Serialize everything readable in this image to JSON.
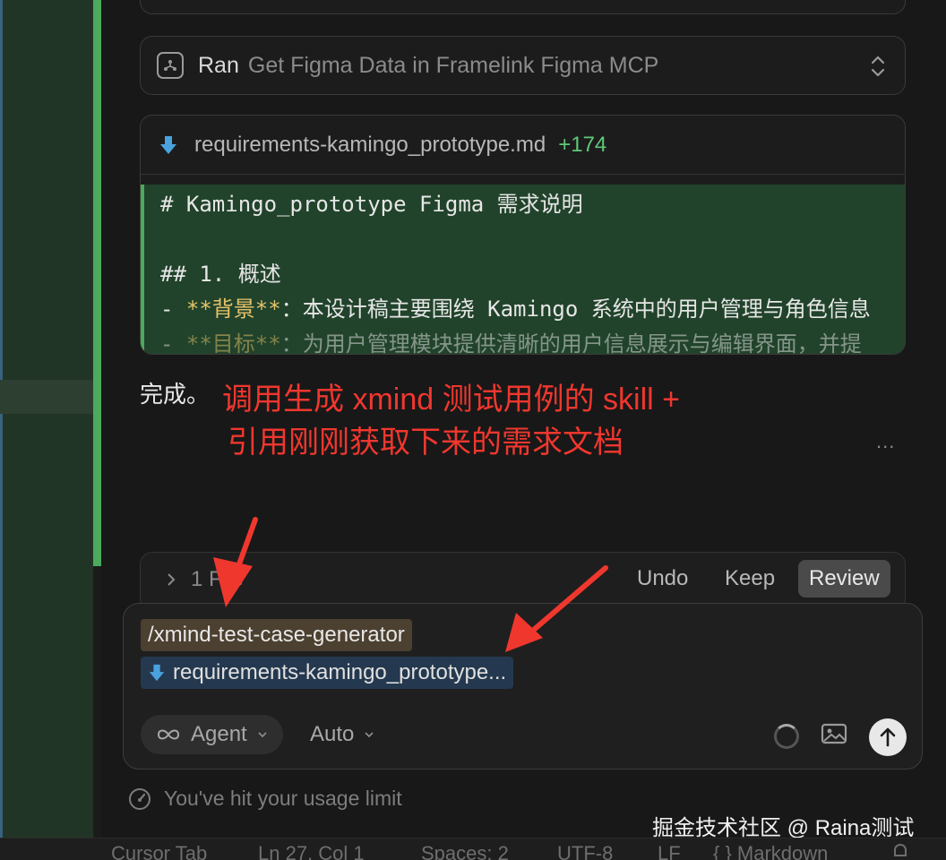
{
  "ran_card": {
    "prefix": "Ran",
    "tool": "Get Figma Data in Framelink Figma MCP"
  },
  "file_card": {
    "filename": "requirements-kamingo_prototype.md",
    "added": "+174",
    "lines": [
      {
        "text": "# Kamingo_prototype Figma 需求说明"
      },
      {
        "text": ""
      },
      {
        "text": "## 1. 概述"
      },
      {
        "prefix": "- ",
        "bold": "**背景**",
        "rest": "：本设计稿主要围绕 Kamingo 系统中的用户管理与角色信息"
      },
      {
        "prefix": "- ",
        "bold": "**目标**",
        "rest": "：为用户管理模块提供清晰的用户信息展示与编辑界面，并提"
      }
    ]
  },
  "message": {
    "done": "完成。"
  },
  "annotation": {
    "line1": "调用生成 xmind 测试用例的 skill +",
    "line2": "引用刚刚获取下来的需求文档",
    "color": "#f0372e"
  },
  "more_label": "...",
  "review_bar": {
    "files_label": "1 File",
    "undo": "Undo",
    "keep": "Keep",
    "review": "Review"
  },
  "composer": {
    "command_chip": "/xmind-test-case-generator",
    "file_chip": "requirements-kamingo_prototype...",
    "mode_label": "Agent",
    "model_label": "Auto"
  },
  "usage": {
    "text": "You've hit your usage limit"
  },
  "watermark": "掘金技术社区 @ Raina测试",
  "status_bar": {
    "items": [
      "Cursor Tab",
      "Ln 27, Col 1",
      "Spaces: 2",
      "UTF-8",
      "LF",
      "{ } Markdown"
    ]
  },
  "icons": {
    "tool": "mcp-tool-icon",
    "download": "download-arrow-icon",
    "send": "send-arrow-up-icon"
  },
  "colors": {
    "accent_green": "#4caa5d",
    "added_green": "#5fc878",
    "diff_bg": "#21432b",
    "file_chip_bg": "#24394f",
    "cmd_chip_bg": "#4c4030"
  }
}
